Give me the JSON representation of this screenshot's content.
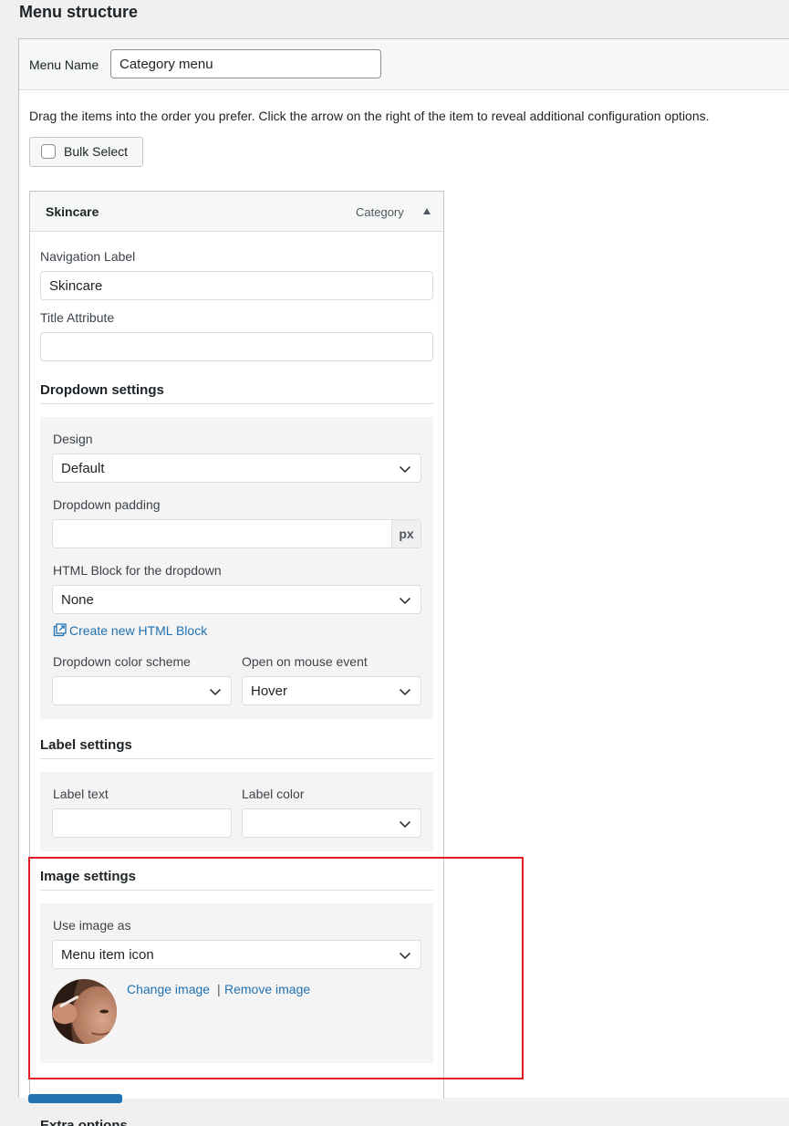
{
  "page": {
    "title": "Menu structure"
  },
  "menu_name": {
    "label": "Menu Name",
    "value": "Category menu"
  },
  "instructions": "Drag the items into the order you prefer. Click the arrow on the right of the item to reveal additional configuration options.",
  "bulk_select": {
    "label": "Bulk Select"
  },
  "item": {
    "title": "Skincare",
    "type": "Category",
    "navigation_label": {
      "label": "Navigation Label",
      "value": "Skincare"
    },
    "title_attribute": {
      "label": "Title Attribute",
      "value": ""
    }
  },
  "dropdown_settings": {
    "title": "Dropdown settings",
    "design": {
      "label": "Design",
      "value": "Default"
    },
    "padding": {
      "label": "Dropdown padding",
      "value": "",
      "unit": "px"
    },
    "html_block": {
      "label": "HTML Block for the dropdown",
      "value": "None"
    },
    "create_link": "Create new HTML Block",
    "color_scheme": {
      "label": "Dropdown color scheme",
      "value": ""
    },
    "mouse_event": {
      "label": "Open on mouse event",
      "value": "Hover"
    }
  },
  "label_settings": {
    "title": "Label settings",
    "label_text": {
      "label": "Label text",
      "value": ""
    },
    "label_color": {
      "label": "Label color",
      "value": ""
    }
  },
  "image_settings": {
    "title": "Image settings",
    "use_image_as": {
      "label": "Use image as",
      "value": "Menu item icon"
    },
    "change_image": "Change image",
    "separator": "|",
    "remove_image": "Remove image"
  },
  "extra_options": {
    "title": "Extra options"
  },
  "colors": {
    "link": "#2271b1",
    "highlight": "#e01b24",
    "panel_bg": "#f4f4f4"
  }
}
